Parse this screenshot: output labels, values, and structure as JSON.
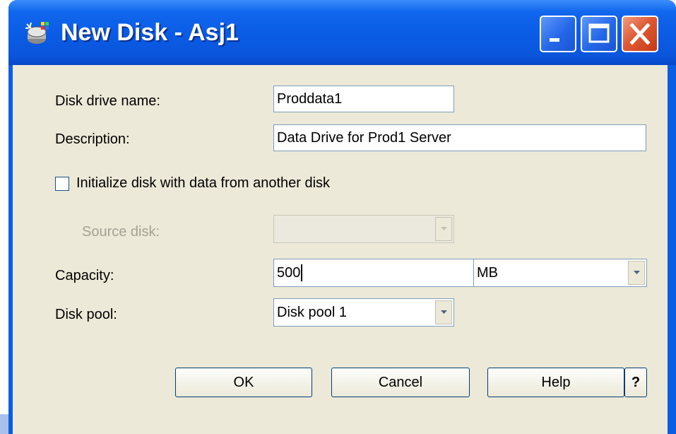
{
  "window": {
    "title": "New Disk - Asj1",
    "app_icon": "disk-wizard-icon",
    "controls": [
      "minimize-icon",
      "maximize-icon",
      "close-icon"
    ]
  },
  "form": {
    "disk_name": {
      "label": "Disk drive name:",
      "value": "Proddata1"
    },
    "description": {
      "label": "Description:",
      "value": "Data Drive for Prod1 Server"
    },
    "initialize": {
      "label": "Initialize disk with data from another disk",
      "checked": false
    },
    "source_disk": {
      "label": "Source disk:",
      "value": "",
      "enabled": false
    },
    "capacity": {
      "label": "Capacity:",
      "value": "500",
      "unit": "MB"
    },
    "disk_pool": {
      "label": "Disk pool:",
      "value": "Disk pool 1"
    }
  },
  "buttons": {
    "ok": "OK",
    "cancel": "Cancel",
    "help": "Help",
    "whats_this": "?"
  },
  "colors": {
    "titlebar": "#0a5be4",
    "dialog_bg": "#ece9d8",
    "close_button": "#df5a34"
  }
}
